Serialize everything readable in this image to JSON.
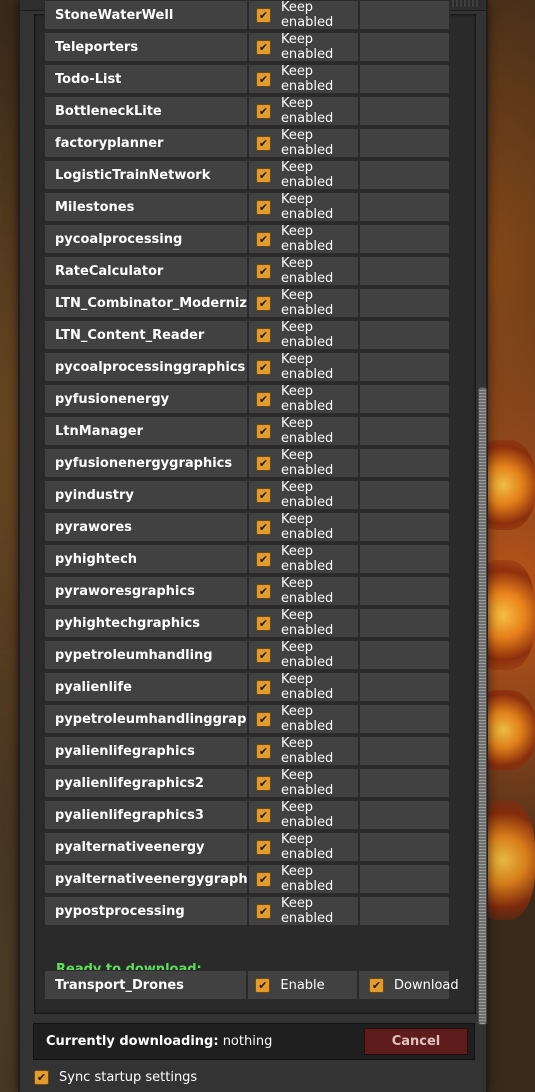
{
  "mods": [
    {
      "name": "StoneWaterWell",
      "status": "Keep enabled"
    },
    {
      "name": "Teleporters",
      "status": "Keep enabled"
    },
    {
      "name": "Todo-List",
      "status": "Keep enabled"
    },
    {
      "name": "BottleneckLite",
      "status": "Keep enabled"
    },
    {
      "name": "factoryplanner",
      "status": "Keep enabled"
    },
    {
      "name": "LogisticTrainNetwork",
      "status": "Keep enabled"
    },
    {
      "name": "Milestones",
      "status": "Keep enabled"
    },
    {
      "name": "pycoalprocessing",
      "status": "Keep enabled"
    },
    {
      "name": "RateCalculator",
      "status": "Keep enabled"
    },
    {
      "name": "LTN_Combinator_Modernized",
      "status": "Keep enabled"
    },
    {
      "name": "LTN_Content_Reader",
      "status": "Keep enabled"
    },
    {
      "name": "pycoalprocessinggraphics",
      "status": "Keep enabled"
    },
    {
      "name": "pyfusionenergy",
      "status": "Keep enabled"
    },
    {
      "name": "LtnManager",
      "status": "Keep enabled"
    },
    {
      "name": "pyfusionenergygraphics",
      "status": "Keep enabled"
    },
    {
      "name": "pyindustry",
      "status": "Keep enabled"
    },
    {
      "name": "pyrawores",
      "status": "Keep enabled"
    },
    {
      "name": "pyhightech",
      "status": "Keep enabled"
    },
    {
      "name": "pyraworesgraphics",
      "status": "Keep enabled"
    },
    {
      "name": "pyhightechgraphics",
      "status": "Keep enabled"
    },
    {
      "name": "pypetroleumhandling",
      "status": "Keep enabled"
    },
    {
      "name": "pyalienlife",
      "status": "Keep enabled"
    },
    {
      "name": "pypetroleumhandlinggraphics",
      "status": "Keep enabled"
    },
    {
      "name": "pyalienlifegraphics",
      "status": "Keep enabled"
    },
    {
      "name": "pyalienlifegraphics2",
      "status": "Keep enabled"
    },
    {
      "name": "pyalienlifegraphics3",
      "status": "Keep enabled"
    },
    {
      "name": "pyalternativeenergy",
      "status": "Keep enabled"
    },
    {
      "name": "pyalternativeenergygraphics",
      "status": "Keep enabled"
    },
    {
      "name": "pypostprocessing",
      "status": "Keep enabled"
    }
  ],
  "ready_header": "Ready to download:",
  "download_mods": [
    {
      "name": "Transport_Drones",
      "enable": "Enable",
      "download": "Download"
    }
  ],
  "download_bar": {
    "label": "Currently downloading:",
    "value": "nothing",
    "cancel": "Cancel"
  },
  "sync_label": "Sync startup settings",
  "checkbox_glyph": "✔",
  "colors": {
    "checkbox": "#e39b2e",
    "ready": "#5ce05c",
    "cancel": "#5e1c1c",
    "panel": "#333333"
  }
}
